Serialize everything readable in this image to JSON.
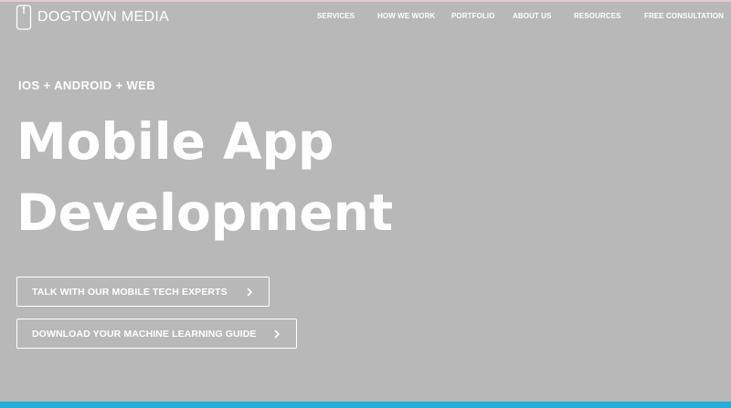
{
  "brand": {
    "name": "DOGTOWN MEDIA",
    "logo_icon": "phone-outline-icon"
  },
  "nav": {
    "items": [
      {
        "label": "SERVICES"
      },
      {
        "label": "HOW WE WORK"
      },
      {
        "label": "PORTFOLIO"
      },
      {
        "label": "ABOUT US"
      },
      {
        "label": "RESOURCES"
      },
      {
        "label": "FREE CONSULTATION"
      }
    ]
  },
  "hero": {
    "eyebrow": "IOS + ANDROID + WEB",
    "headline_line1": "Mobile App",
    "headline_line2": "Development",
    "cta_primary": "TALK WITH OUR MOBILE TECH EXPERTS",
    "cta_secondary": "DOWNLOAD YOUR MACHINE LEARNING GUIDE",
    "cta_icon": "chevron-right-icon"
  },
  "colors": {
    "background": "#b8b8b8",
    "text": "#ffffff",
    "accent_bottom_bar": "#22b0d6",
    "top_line": "#e8c4d2"
  }
}
